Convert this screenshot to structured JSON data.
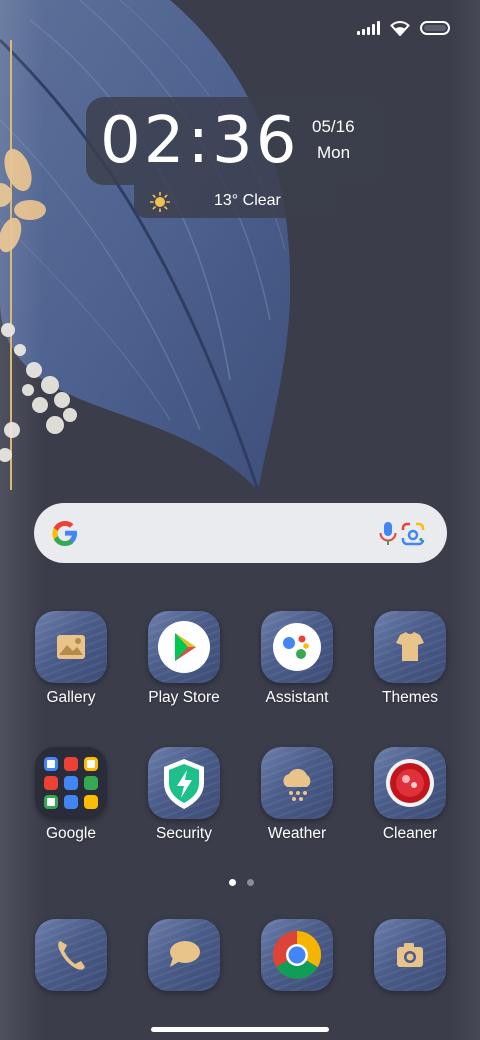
{
  "status_bar": {
    "icons": [
      "signal-icon",
      "wifi-icon",
      "battery-icon"
    ]
  },
  "clock_widget": {
    "time": "02:36",
    "date": "05/16",
    "day": "Mon",
    "weather": "13° Clear",
    "weather_icon": "sun-icon"
  },
  "search": {
    "icons": [
      "google-g-icon",
      "mic-icon",
      "lens-icon"
    ]
  },
  "apps_row1": [
    {
      "label": "Gallery",
      "icon": "gallery-icon"
    },
    {
      "label": "Play Store",
      "icon": "play-store-icon"
    },
    {
      "label": "Assistant",
      "icon": "assistant-icon"
    },
    {
      "label": "Themes",
      "icon": "themes-icon"
    }
  ],
  "apps_row2": [
    {
      "label": "Google",
      "icon": "google-folder-icon"
    },
    {
      "label": "Security",
      "icon": "security-icon"
    },
    {
      "label": "Weather",
      "icon": "weather-icon"
    },
    {
      "label": "Cleaner",
      "icon": "cleaner-icon"
    }
  ],
  "page_indicator": {
    "pages": 2,
    "current": 1
  },
  "dock": [
    {
      "icon": "phone-icon"
    },
    {
      "icon": "messages-icon"
    },
    {
      "icon": "chrome-icon"
    },
    {
      "icon": "camera-icon"
    }
  ],
  "colors": {
    "background": "#3b3d4b",
    "icon_tile": "#4a5c89",
    "accent_gold": "#e8c48a"
  }
}
